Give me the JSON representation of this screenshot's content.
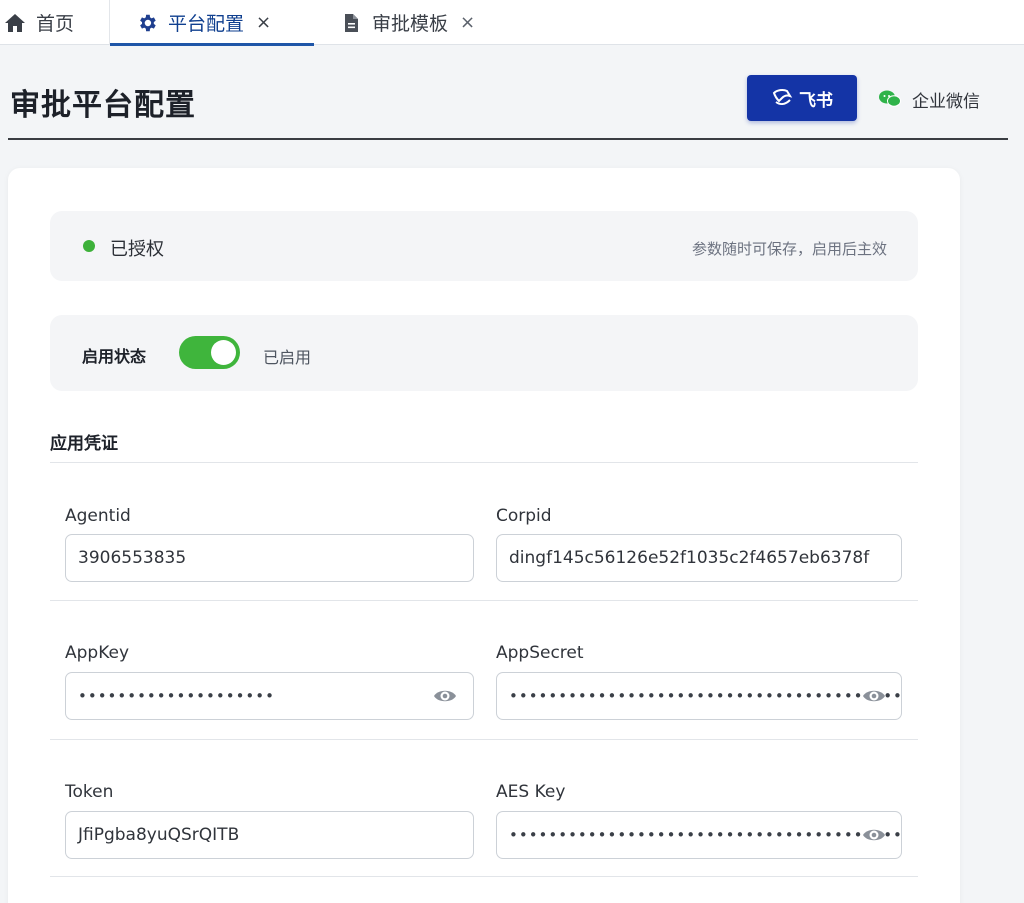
{
  "tabs": [
    {
      "label": "首页",
      "icon": "home-icon"
    },
    {
      "label": "平台配置",
      "icon": "gear-icon",
      "active": true,
      "closable": true
    },
    {
      "label": "审批模板",
      "icon": "document-icon",
      "closable": true
    }
  ],
  "tab_close_glyph": "×",
  "page": {
    "title": "审批平台配置",
    "platforms": [
      {
        "label": "飞书",
        "icon": "feishu-icon",
        "selected": true
      },
      {
        "label": "企业微信",
        "icon": "wechat-icon",
        "selected": false
      }
    ]
  },
  "auth": {
    "status": "已授权",
    "hint": "参数随时可保存，启用后主效"
  },
  "enable": {
    "label": "启用状态",
    "value": "已启用",
    "on": true
  },
  "credentials": {
    "title": "应用凭证",
    "fields": {
      "agentid": {
        "label": "Agentid",
        "value": "3906553835"
      },
      "corpid": {
        "label": "Corpid",
        "value": "dingf145c56126e52f1035c2f4657eb6378f"
      },
      "appkey": {
        "label": "AppKey",
        "value": "••••••••••••••••••••"
      },
      "appsecret": {
        "label": "AppSecret",
        "value": "••••••••••••••••••••••••••••••••••••••••••••"
      },
      "token": {
        "label": "Token",
        "value": "JfiPgba8yuQSrQITB"
      },
      "aeskey": {
        "label": "AES Key",
        "value": "••••••••••••••••••••••••••••••••••••••••"
      }
    }
  },
  "colors": {
    "accent": "#1434a6",
    "tab_active": "#1f56a8",
    "success": "#3db13a",
    "toggle_on": "#3fb53c"
  }
}
